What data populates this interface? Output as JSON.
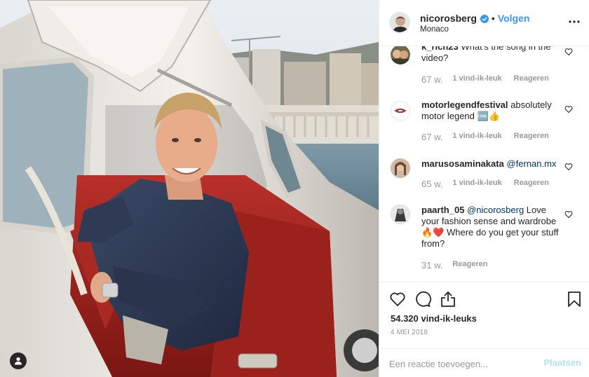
{
  "post": {
    "username": "nicorosberg",
    "separator": "•",
    "follow_label": "Volgen",
    "location": "Monaco",
    "verified_icon": "verified-badge-icon",
    "more_icon": "more-options-icon"
  },
  "comments": [
    {
      "username": "k_rich23",
      "text": "What's the song in the video?",
      "age": "67 w.",
      "likes": "1 vind-ik-leuk",
      "reply": "Reageren",
      "avatar_color": "#6b6b52"
    },
    {
      "username": "motorlegendfestival",
      "text": "absolutely motor legend",
      "emoji": "🆒👍",
      "age": "67 w.",
      "likes": "1 vind-ik-leuk",
      "reply": "Reageren",
      "avatar_color": "#ffffff"
    },
    {
      "username": "marusosaminakata",
      "mention": "@fernan.mx",
      "age": "65 w.",
      "likes": "1 vind-ik-leuk",
      "reply": "Reageren",
      "avatar_color": "#b9a08c"
    },
    {
      "username": "paarth_05",
      "mention": "@nicorosberg",
      "text_a": "Love your fashion sense and wardrobe",
      "emoji": "🔥❤️",
      "text_b": "Where do you get your stuff from?",
      "age": "31 w.",
      "reply": "Reageren",
      "avatar_color": "#444444"
    }
  ],
  "actions": {
    "like_icon": "heart-icon",
    "comment_icon": "comment-bubble-icon",
    "share_icon": "share-icon",
    "save_icon": "bookmark-icon",
    "likes_count": "54.320 vind-ik-leuks",
    "date": "4 MEI 2018"
  },
  "comment_box": {
    "placeholder": "Een reactie toevoegen...",
    "post_label": "Plaatsen"
  },
  "colors": {
    "link_blue": "#3897f0",
    "post_button_disabled": "#b2dffc",
    "meta_gray": "#999999",
    "border": "#efefef"
  }
}
